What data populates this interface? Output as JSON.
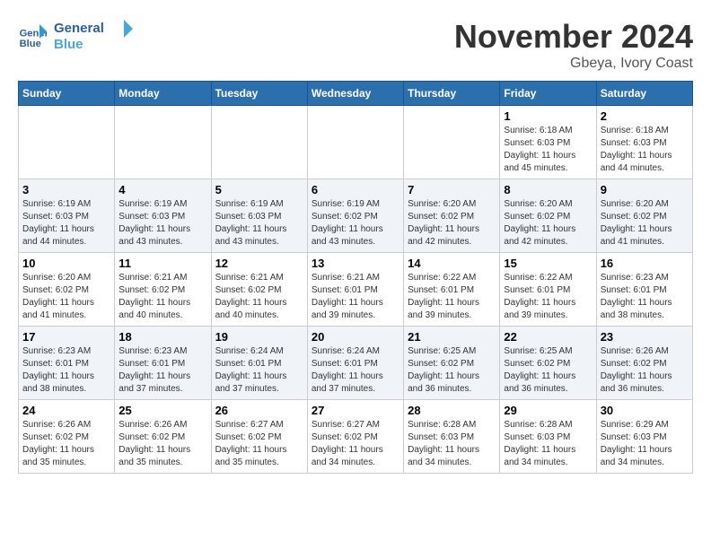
{
  "header": {
    "logo_line1": "General",
    "logo_line2": "Blue",
    "month": "November 2024",
    "location": "Gbeya, Ivory Coast"
  },
  "days_of_week": [
    "Sunday",
    "Monday",
    "Tuesday",
    "Wednesday",
    "Thursday",
    "Friday",
    "Saturday"
  ],
  "weeks": [
    [
      {
        "day": "",
        "info": ""
      },
      {
        "day": "",
        "info": ""
      },
      {
        "day": "",
        "info": ""
      },
      {
        "day": "",
        "info": ""
      },
      {
        "day": "",
        "info": ""
      },
      {
        "day": "1",
        "info": "Sunrise: 6:18 AM\nSunset: 6:03 PM\nDaylight: 11 hours\nand 45 minutes."
      },
      {
        "day": "2",
        "info": "Sunrise: 6:18 AM\nSunset: 6:03 PM\nDaylight: 11 hours\nand 44 minutes."
      }
    ],
    [
      {
        "day": "3",
        "info": "Sunrise: 6:19 AM\nSunset: 6:03 PM\nDaylight: 11 hours\nand 44 minutes."
      },
      {
        "day": "4",
        "info": "Sunrise: 6:19 AM\nSunset: 6:03 PM\nDaylight: 11 hours\nand 43 minutes."
      },
      {
        "day": "5",
        "info": "Sunrise: 6:19 AM\nSunset: 6:03 PM\nDaylight: 11 hours\nand 43 minutes."
      },
      {
        "day": "6",
        "info": "Sunrise: 6:19 AM\nSunset: 6:02 PM\nDaylight: 11 hours\nand 43 minutes."
      },
      {
        "day": "7",
        "info": "Sunrise: 6:20 AM\nSunset: 6:02 PM\nDaylight: 11 hours\nand 42 minutes."
      },
      {
        "day": "8",
        "info": "Sunrise: 6:20 AM\nSunset: 6:02 PM\nDaylight: 11 hours\nand 42 minutes."
      },
      {
        "day": "9",
        "info": "Sunrise: 6:20 AM\nSunset: 6:02 PM\nDaylight: 11 hours\nand 41 minutes."
      }
    ],
    [
      {
        "day": "10",
        "info": "Sunrise: 6:20 AM\nSunset: 6:02 PM\nDaylight: 11 hours\nand 41 minutes."
      },
      {
        "day": "11",
        "info": "Sunrise: 6:21 AM\nSunset: 6:02 PM\nDaylight: 11 hours\nand 40 minutes."
      },
      {
        "day": "12",
        "info": "Sunrise: 6:21 AM\nSunset: 6:02 PM\nDaylight: 11 hours\nand 40 minutes."
      },
      {
        "day": "13",
        "info": "Sunrise: 6:21 AM\nSunset: 6:01 PM\nDaylight: 11 hours\nand 39 minutes."
      },
      {
        "day": "14",
        "info": "Sunrise: 6:22 AM\nSunset: 6:01 PM\nDaylight: 11 hours\nand 39 minutes."
      },
      {
        "day": "15",
        "info": "Sunrise: 6:22 AM\nSunset: 6:01 PM\nDaylight: 11 hours\nand 39 minutes."
      },
      {
        "day": "16",
        "info": "Sunrise: 6:23 AM\nSunset: 6:01 PM\nDaylight: 11 hours\nand 38 minutes."
      }
    ],
    [
      {
        "day": "17",
        "info": "Sunrise: 6:23 AM\nSunset: 6:01 PM\nDaylight: 11 hours\nand 38 minutes."
      },
      {
        "day": "18",
        "info": "Sunrise: 6:23 AM\nSunset: 6:01 PM\nDaylight: 11 hours\nand 37 minutes."
      },
      {
        "day": "19",
        "info": "Sunrise: 6:24 AM\nSunset: 6:01 PM\nDaylight: 11 hours\nand 37 minutes."
      },
      {
        "day": "20",
        "info": "Sunrise: 6:24 AM\nSunset: 6:01 PM\nDaylight: 11 hours\nand 37 minutes."
      },
      {
        "day": "21",
        "info": "Sunrise: 6:25 AM\nSunset: 6:02 PM\nDaylight: 11 hours\nand 36 minutes."
      },
      {
        "day": "22",
        "info": "Sunrise: 6:25 AM\nSunset: 6:02 PM\nDaylight: 11 hours\nand 36 minutes."
      },
      {
        "day": "23",
        "info": "Sunrise: 6:26 AM\nSunset: 6:02 PM\nDaylight: 11 hours\nand 36 minutes."
      }
    ],
    [
      {
        "day": "24",
        "info": "Sunrise: 6:26 AM\nSunset: 6:02 PM\nDaylight: 11 hours\nand 35 minutes."
      },
      {
        "day": "25",
        "info": "Sunrise: 6:26 AM\nSunset: 6:02 PM\nDaylight: 11 hours\nand 35 minutes."
      },
      {
        "day": "26",
        "info": "Sunrise: 6:27 AM\nSunset: 6:02 PM\nDaylight: 11 hours\nand 35 minutes."
      },
      {
        "day": "27",
        "info": "Sunrise: 6:27 AM\nSunset: 6:02 PM\nDaylight: 11 hours\nand 34 minutes."
      },
      {
        "day": "28",
        "info": "Sunrise: 6:28 AM\nSunset: 6:03 PM\nDaylight: 11 hours\nand 34 minutes."
      },
      {
        "day": "29",
        "info": "Sunrise: 6:28 AM\nSunset: 6:03 PM\nDaylight: 11 hours\nand 34 minutes."
      },
      {
        "day": "30",
        "info": "Sunrise: 6:29 AM\nSunset: 6:03 PM\nDaylight: 11 hours\nand 34 minutes."
      }
    ]
  ]
}
